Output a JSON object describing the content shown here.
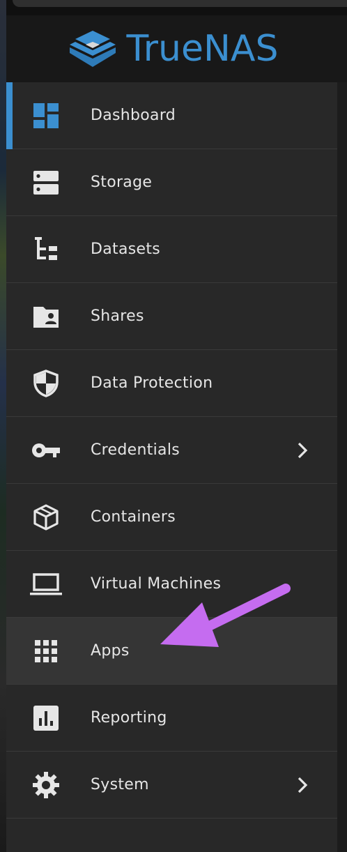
{
  "app": {
    "brand": {
      "name": "TrueNAS",
      "brand_color": "#3b8fd0"
    }
  },
  "nav": {
    "active_color": "#3b8fd0",
    "items": [
      {
        "label": "Dashboard",
        "icon": "dashboard-icon",
        "active": true
      },
      {
        "label": "Storage",
        "icon": "storage-icon"
      },
      {
        "label": "Datasets",
        "icon": "datasets-icon"
      },
      {
        "label": "Shares",
        "icon": "shared-folder-icon"
      },
      {
        "label": "Data Protection",
        "icon": "shield-icon"
      },
      {
        "label": "Credentials",
        "icon": "key-icon",
        "has_submenu": true
      },
      {
        "label": "Containers",
        "icon": "cube-icon"
      },
      {
        "label": "Virtual Machines",
        "icon": "laptop-icon"
      },
      {
        "label": "Apps",
        "icon": "apps-grid-icon",
        "hovered": true
      },
      {
        "label": "Reporting",
        "icon": "bar-chart-icon"
      },
      {
        "label": "System",
        "icon": "gear-icon",
        "has_submenu": true
      }
    ]
  },
  "annotation": {
    "icon": "arrow-icon",
    "color": "#c56cf0",
    "points_to": "Apps"
  }
}
